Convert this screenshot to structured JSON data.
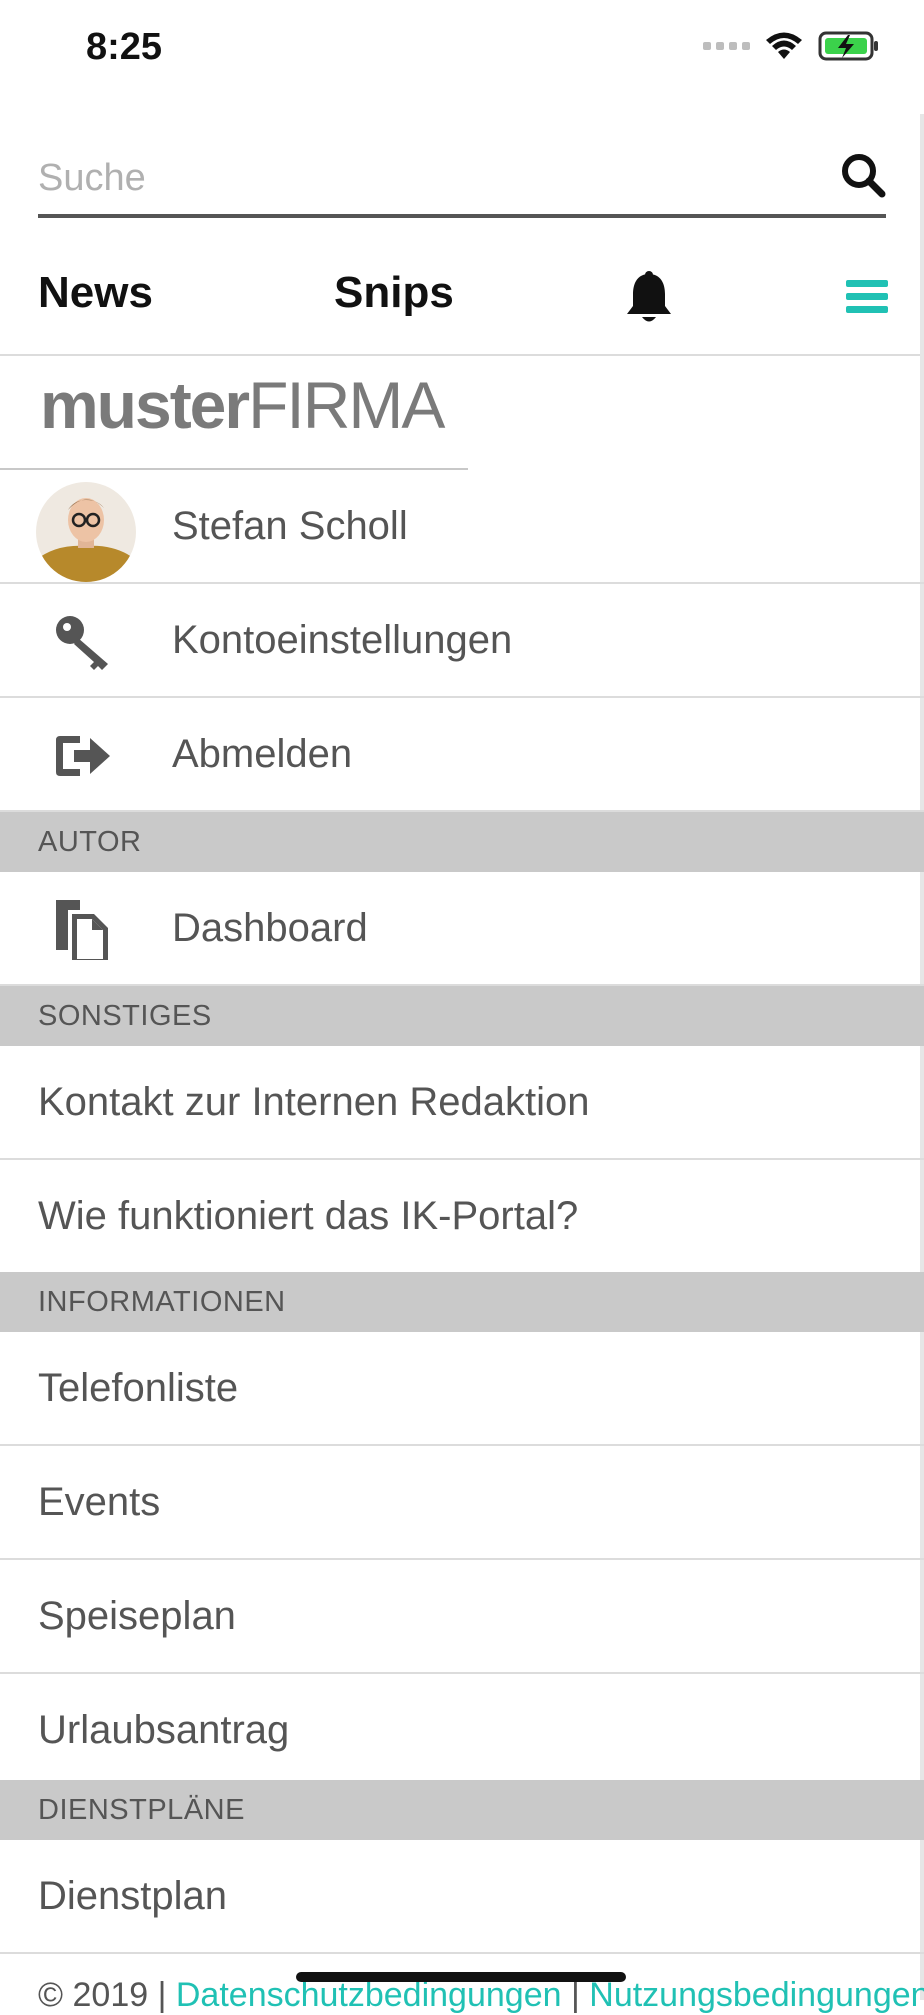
{
  "status": {
    "time": "8:25"
  },
  "search": {
    "placeholder": "Suche"
  },
  "nav": {
    "news": "News",
    "snips": "Snips"
  },
  "colors": {
    "accent": "#20c1b4",
    "section_bg": "#c9c9c9"
  },
  "logo": {
    "part1": "muster",
    "part2": "FIRMA"
  },
  "account": {
    "user_name": "Stefan Scholl",
    "settings": "Kontoeinstellungen",
    "logout": "Abmelden"
  },
  "sections": {
    "autor": {
      "title": "AUTOR",
      "items": [
        "Dashboard"
      ]
    },
    "sonstiges": {
      "title": "SONSTIGES",
      "items": [
        "Kontakt zur Internen Redaktion",
        "Wie funktioniert das IK-Portal?"
      ]
    },
    "informationen": {
      "title": "INFORMATIONEN",
      "items": [
        "Telefonliste",
        "Events",
        "Speiseplan",
        "Urlaubsantrag"
      ]
    },
    "dienstplaene": {
      "title": "DIENSTPLÄNE",
      "items": [
        "Dienstplan"
      ]
    }
  },
  "footer": {
    "copyright": "© 2019 |",
    "privacy": "Datenschutzbedingungen",
    "sep": "|",
    "terms": "Nutzungsbedingungen"
  },
  "icons": [
    "search-icon",
    "bell-icon",
    "menu-icon",
    "key-icon",
    "logout-icon",
    "dashboard-icon"
  ]
}
